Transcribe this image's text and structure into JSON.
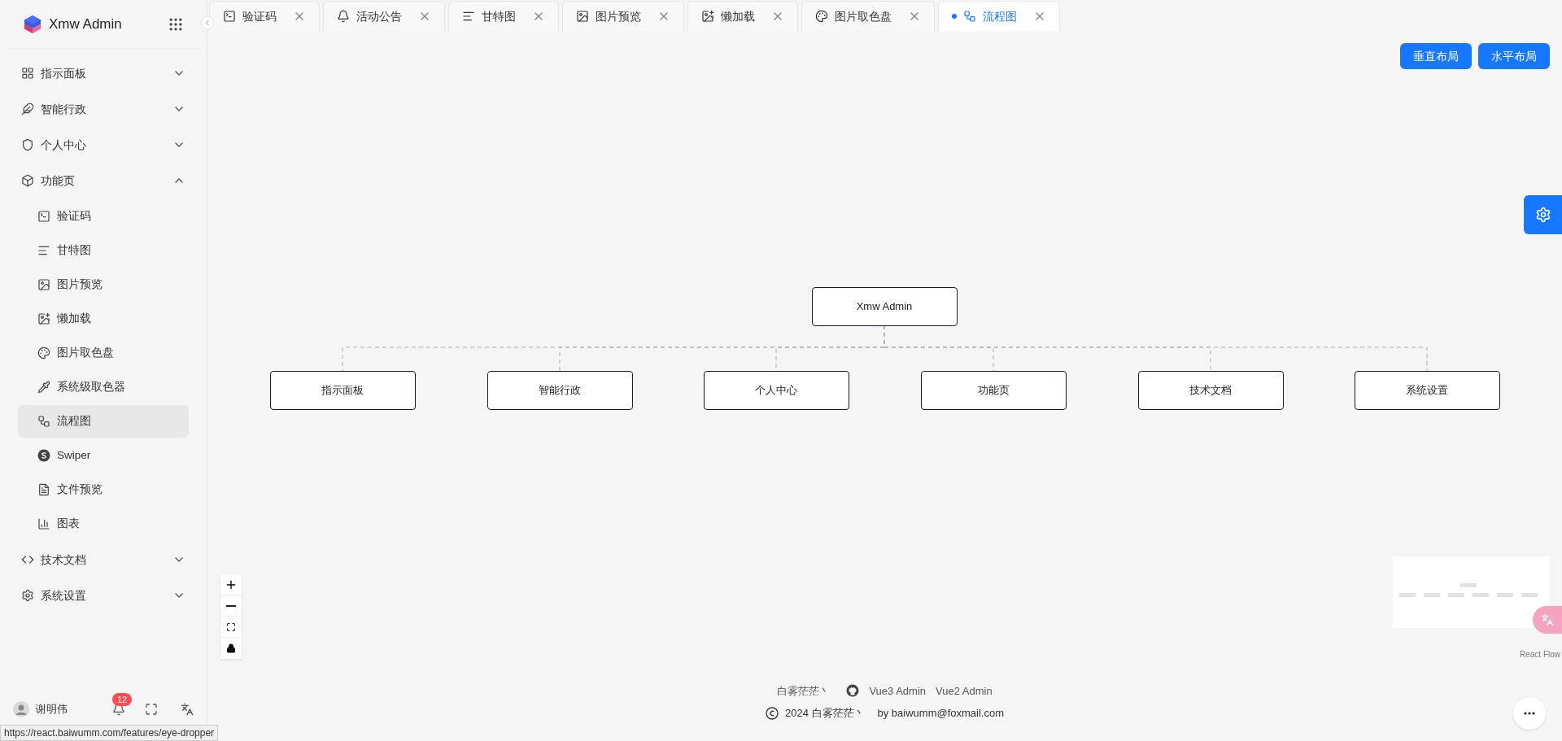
{
  "sidebar": {
    "logo_text": "Xmw Admin",
    "menu": [
      {
        "label": "指示面板",
        "expanded": false
      },
      {
        "label": "智能行政",
        "expanded": false
      },
      {
        "label": "个人中心",
        "expanded": false
      },
      {
        "label": "功能页",
        "expanded": true,
        "children": [
          {
            "label": "验证码",
            "selected": false
          },
          {
            "label": "甘特图",
            "selected": false
          },
          {
            "label": "图片预览",
            "selected": false
          },
          {
            "label": "懒加载",
            "selected": false
          },
          {
            "label": "图片取色盘",
            "selected": false
          },
          {
            "label": "系统级取色器",
            "selected": false
          },
          {
            "label": "流程图",
            "selected": true
          },
          {
            "label": "Swiper",
            "selected": false
          },
          {
            "label": "文件预览",
            "selected": false
          },
          {
            "label": "图表",
            "selected": false
          }
        ]
      },
      {
        "label": "技术文档",
        "expanded": false
      },
      {
        "label": "系统设置",
        "expanded": false
      }
    ],
    "user": {
      "name": "谢明伟",
      "badge": "12"
    }
  },
  "tabs": [
    {
      "label": "验证码",
      "selected": false
    },
    {
      "label": "活动公告",
      "selected": false
    },
    {
      "label": "甘特图",
      "selected": false
    },
    {
      "label": "图片预览",
      "selected": false
    },
    {
      "label": "懒加载",
      "selected": false
    },
    {
      "label": "图片取色盘",
      "selected": false
    },
    {
      "label": "流程图",
      "selected": true
    }
  ],
  "toolbar_buttons": [
    "垂直布局",
    "水平布局"
  ],
  "flow": {
    "root": "Xmw Admin",
    "children": [
      "指示面板",
      "智能行政",
      "个人中心",
      "功能页",
      "技术文档",
      "系统设置"
    ],
    "attribution": "React Flow"
  },
  "footer": {
    "author": "白雾茫茫丶",
    "links": [
      "Vue3 Admin",
      "Vue2 Admin"
    ],
    "copyright": "2024 白雾茫茫丶",
    "contact": "by baiwumm@foxmail.com"
  },
  "status_url": "https://react.baiwumm.com/features/eye-dropper"
}
